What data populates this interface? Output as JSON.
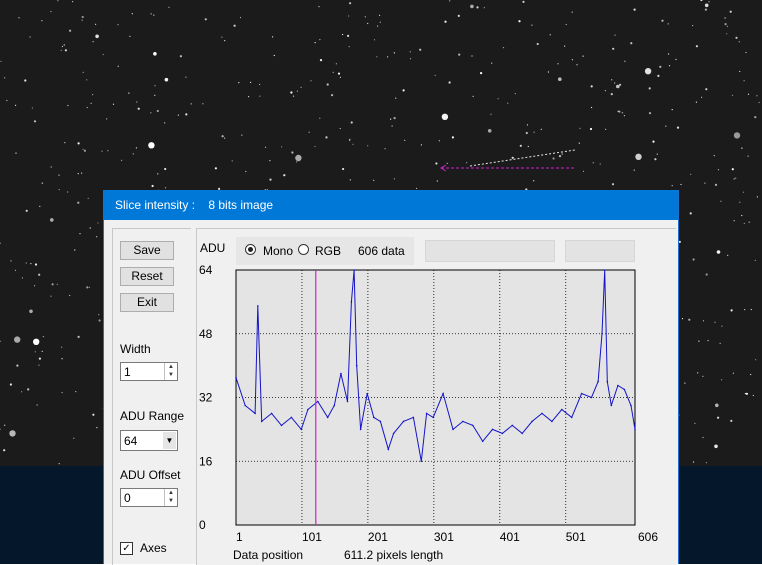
{
  "dialog": {
    "title": "Slice intensity :    8 bits image",
    "buttons": {
      "save": "Save",
      "reset": "Reset",
      "exit": "Exit"
    },
    "width": {
      "label": "Width",
      "value": "1"
    },
    "adu_range": {
      "label": "ADU Range",
      "value": "64"
    },
    "adu_offset": {
      "label": "ADU Offset",
      "value": "0"
    },
    "axes": {
      "label": "Axes",
      "checked": true
    },
    "mode": {
      "mono": "Mono",
      "rgb": "RGB",
      "selected": "Mono"
    },
    "data_count": "606 data",
    "y_axis_title": "ADU",
    "x_axis_title": "Data position",
    "pixels_length": "611.2  pixels length"
  },
  "chart_data": {
    "type": "line",
    "ylabel": "ADU",
    "xlabel": "Data position",
    "xlim": [
      1,
      606
    ],
    "ylim": [
      0,
      64
    ],
    "x_ticks": [
      "1",
      "101",
      "201",
      "301",
      "401",
      "501",
      "606"
    ],
    "y_ticks": [
      "64",
      "48",
      "32",
      "16",
      "0"
    ],
    "grid": true,
    "cursor_x": 122,
    "series": [
      {
        "color": "#1414c8",
        "x": [
          1,
          15,
          30,
          34,
          40,
          55,
          70,
          85,
          100,
          110,
          125,
          140,
          150,
          160,
          170,
          176,
          180,
          184,
          190,
          200,
          210,
          220,
          232,
          240,
          255,
          270,
          282,
          290,
          300,
          315,
          330,
          345,
          360,
          375,
          390,
          405,
          420,
          435,
          450,
          465,
          480,
          495,
          510,
          525,
          540,
          550,
          556,
          560,
          564,
          570,
          580,
          590,
          600,
          606
        ],
        "y": [
          37,
          30,
          28,
          55,
          26,
          28,
          25,
          27,
          24,
          29,
          31,
          27,
          30,
          38,
          31,
          56,
          64,
          40,
          24,
          33,
          27,
          26,
          19,
          23,
          26,
          27,
          16,
          28,
          27,
          33,
          24,
          26,
          25,
          21,
          24,
          23,
          25,
          23,
          26,
          28,
          26,
          29,
          27,
          33,
          32,
          36,
          48,
          64,
          36,
          30,
          35,
          34,
          30,
          24
        ]
      }
    ]
  },
  "colors": {
    "title_bar": "#0078d7",
    "plot_bg": "#e4e4e4",
    "series": "#1414c8",
    "cursor": "#d020d0",
    "overlay_line": "#d020d0"
  }
}
